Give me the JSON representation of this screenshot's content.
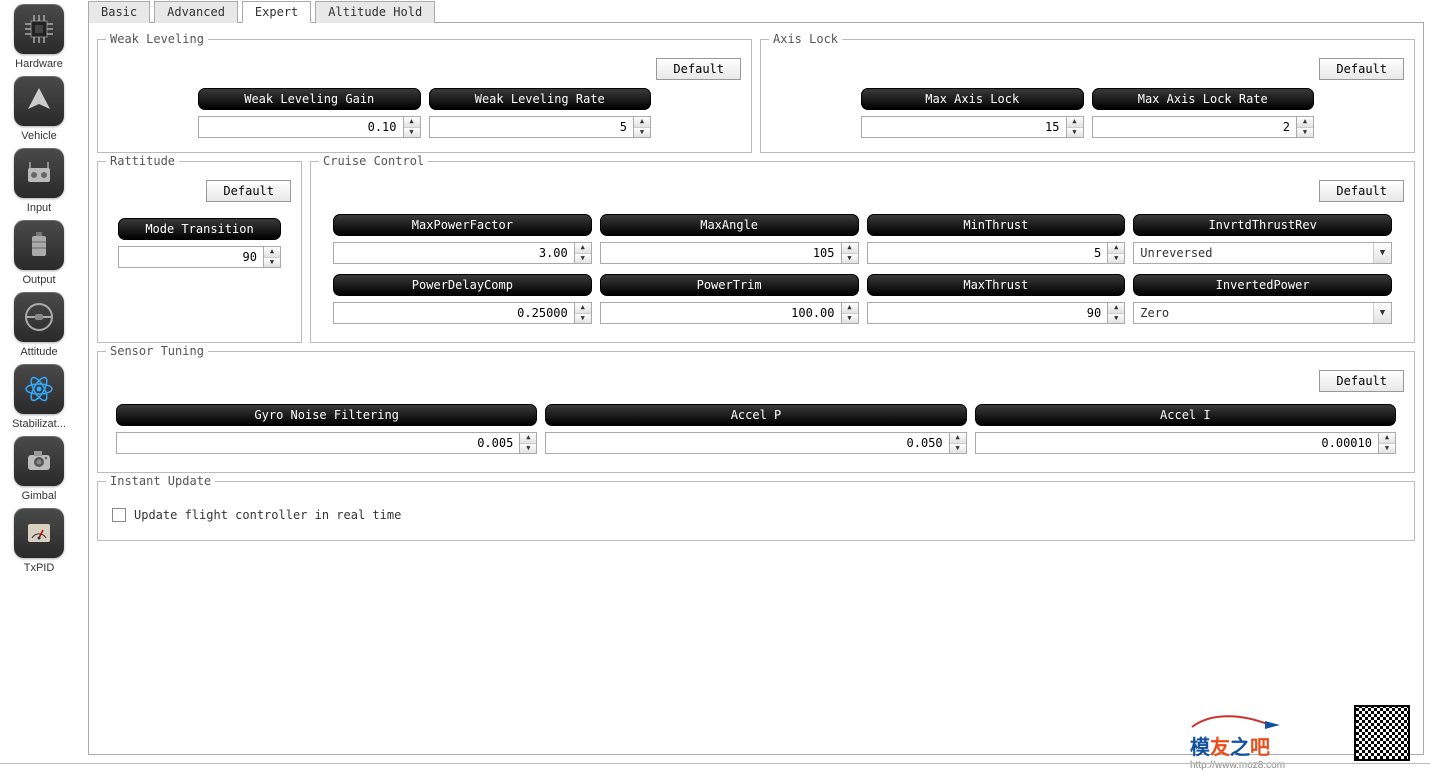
{
  "sidebar": [
    {
      "key": "hardware",
      "label": "Hardware"
    },
    {
      "key": "vehicle",
      "label": "Vehicle"
    },
    {
      "key": "input",
      "label": "Input"
    },
    {
      "key": "output",
      "label": "Output"
    },
    {
      "key": "attitude",
      "label": "Attitude"
    },
    {
      "key": "stabilization",
      "label": "Stabilizat..."
    },
    {
      "key": "gimbal",
      "label": "Gimbal"
    },
    {
      "key": "txpid",
      "label": "TxPID"
    }
  ],
  "tabs": {
    "basic": "Basic",
    "advanced": "Advanced",
    "expert": "Expert",
    "altitude_hold": "Altitude Hold"
  },
  "buttons": {
    "default": "Default"
  },
  "weak_leveling": {
    "title": "Weak Leveling",
    "gain_label": "Weak Leveling Gain",
    "gain_value": "0.10",
    "rate_label": "Weak Leveling Rate",
    "rate_value": "5"
  },
  "axis_lock": {
    "title": "Axis Lock",
    "max_lock_label": "Max Axis Lock",
    "max_lock_value": "15",
    "max_rate_label": "Max Axis Lock Rate",
    "max_rate_value": "2"
  },
  "rattitude": {
    "title": "Rattitude",
    "mode_transition_label": "Mode Transition",
    "mode_transition_value": "90"
  },
  "cruise": {
    "title": "Cruise Control",
    "maxpowerfactor_label": "MaxPowerFactor",
    "maxpowerfactor_value": "3.00",
    "maxangle_label": "MaxAngle",
    "maxangle_value": "105",
    "minthrust_label": "MinThrust",
    "minthrust_value": "5",
    "invrtdthrustrev_label": "InvrtdThrustRev",
    "invrtdthrustrev_value": "Unreversed",
    "powerdelaycomp_label": "PowerDelayComp",
    "powerdelaycomp_value": "0.25000",
    "powertrim_label": "PowerTrim",
    "powertrim_value": "100.00",
    "maxthrust_label": "MaxThrust",
    "maxthrust_value": "90",
    "invertedpower_label": "InvertedPower",
    "invertedpower_value": "Zero"
  },
  "sensor": {
    "title": "Sensor Tuning",
    "gyro_label": "Gyro Noise Filtering",
    "gyro_value": "0.005",
    "accelp_label": "Accel P",
    "accelp_value": "0.050",
    "acceli_label": "Accel I",
    "acceli_value": "0.00010"
  },
  "instant": {
    "title": "Instant Update",
    "checkbox_label": "Update flight controller in real time"
  },
  "watermark": {
    "text": "模友之吧",
    "url": "http://www.moz8.com"
  }
}
